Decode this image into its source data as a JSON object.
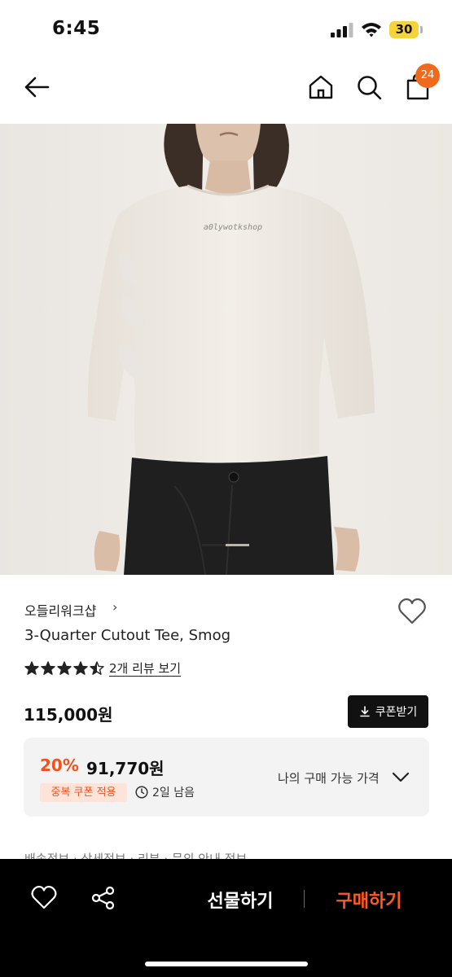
{
  "status_bar": {
    "time": "6:45",
    "battery": "30"
  },
  "nav": {
    "cart_count": "24"
  },
  "product": {
    "shop_name": "오들리워크샵",
    "title": "3-Quarter Cutout Tee, Smog",
    "rating": 4.5,
    "review_link": "2개 리뷰 보기",
    "price": "115,000원",
    "coupon_button": "쿠폰받기",
    "shirt_print": "a0lywotkshop"
  },
  "discount": {
    "rate": "20%",
    "price": "91,770원",
    "badge": "중복 쿠폰 적용",
    "timer": "2일 남음",
    "my_price_label": "나의 구매 가능 가격"
  },
  "below_fold_text": "배송정보 · 상세정보 · 리뷰 · 문의 안내 정보",
  "bottom_bar": {
    "gift_label": "선물하기",
    "buy_label": "구매하기"
  },
  "colors": {
    "accent": "#f0531e",
    "badge": "#f06a1e",
    "buy": "#ff5a1f"
  }
}
